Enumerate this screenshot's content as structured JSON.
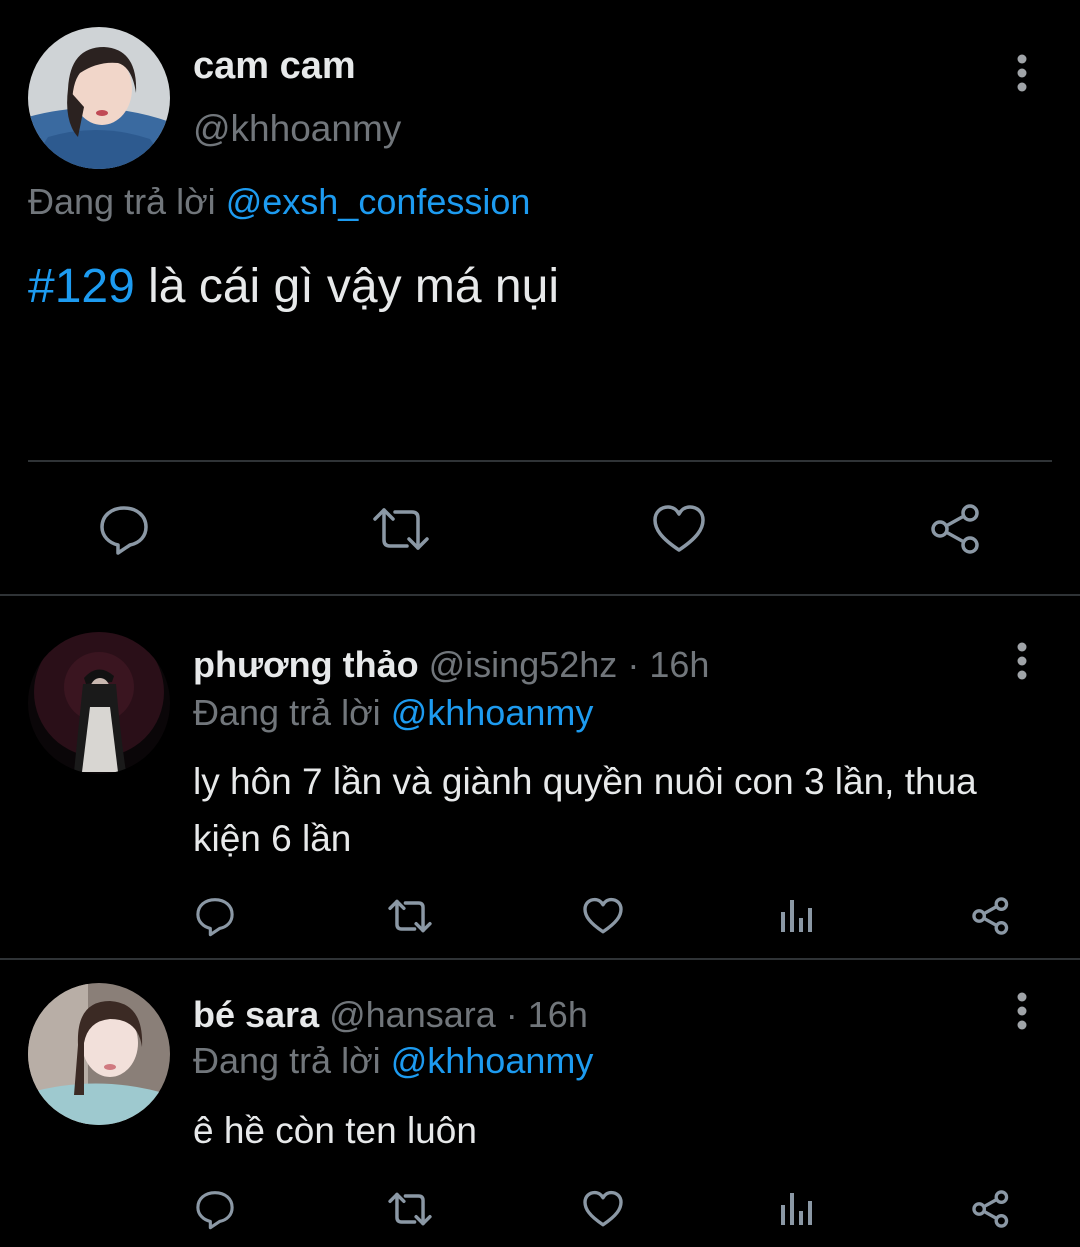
{
  "main": {
    "name": "cam cam",
    "handle": "@khhoanmy",
    "reply_prefix": "Đang trả lời",
    "reply_to": "@exsh_confession",
    "hashtag": "#129",
    "text": " là cái gì vậy má nụi",
    "actions": [
      "comment-icon",
      "retweet-icon",
      "heart-icon",
      "share-icon"
    ]
  },
  "replies": [
    {
      "name": "phương thảo",
      "handle": "@ising52hz",
      "separator": "·",
      "time": "16h",
      "reply_prefix": "Đang trả lời",
      "reply_to": "@khhoanmy",
      "text": "ly hôn 7 lần và giành quyền nuôi con 3 lần, thua kiện 6 lần"
    },
    {
      "name": "bé sara",
      "handle": "@hansara",
      "separator": "·",
      "time": "16h",
      "reply_prefix": "Đang trả lời",
      "reply_to": "@khhoanmy",
      "text": "ê hề còn ten luôn"
    }
  ],
  "colors": {
    "background": "#000000",
    "text": "#e7e9ea",
    "muted": "#71767b",
    "link": "#1d9bf0",
    "divider": "#2f3336"
  }
}
